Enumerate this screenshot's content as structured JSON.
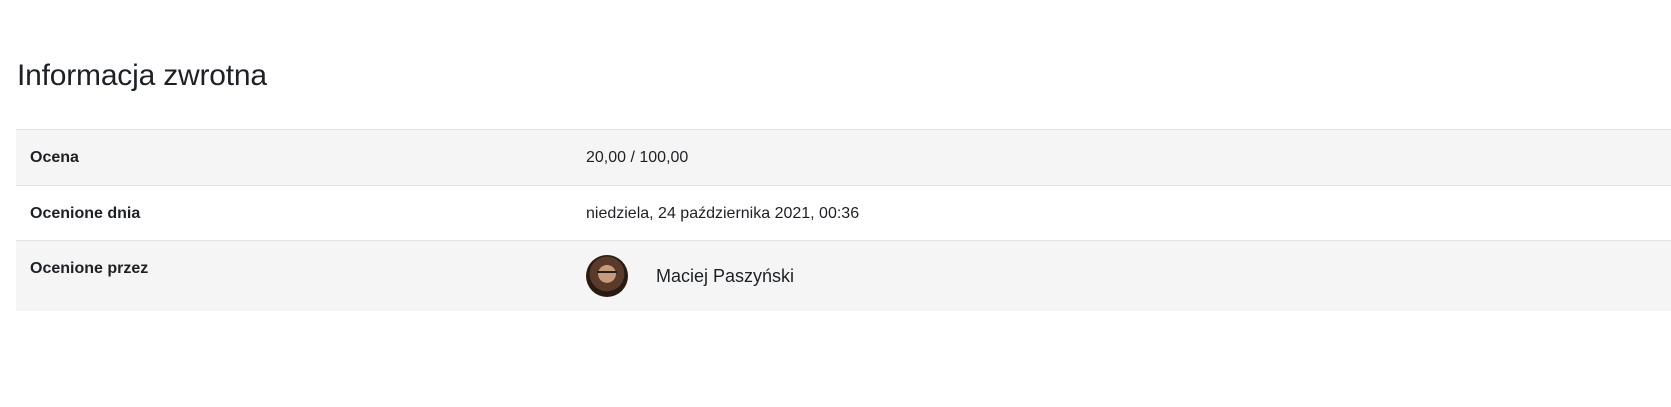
{
  "page": {
    "title": "Informacja zwrotna"
  },
  "feedback": {
    "rows": [
      {
        "label": "Ocena",
        "value": "20,00 / 100,00"
      },
      {
        "label": "Ocenione dnia",
        "value": "niedziela, 24 października 2021, 00:36"
      },
      {
        "label": "Ocenione przez",
        "value": "Maciej Paszyński"
      }
    ]
  },
  "colors": {
    "row_shade": "#f5f5f5",
    "border": "#dee2e6",
    "text": "#1d2125"
  },
  "icons": {
    "grader_avatar": "user-avatar-photo"
  }
}
